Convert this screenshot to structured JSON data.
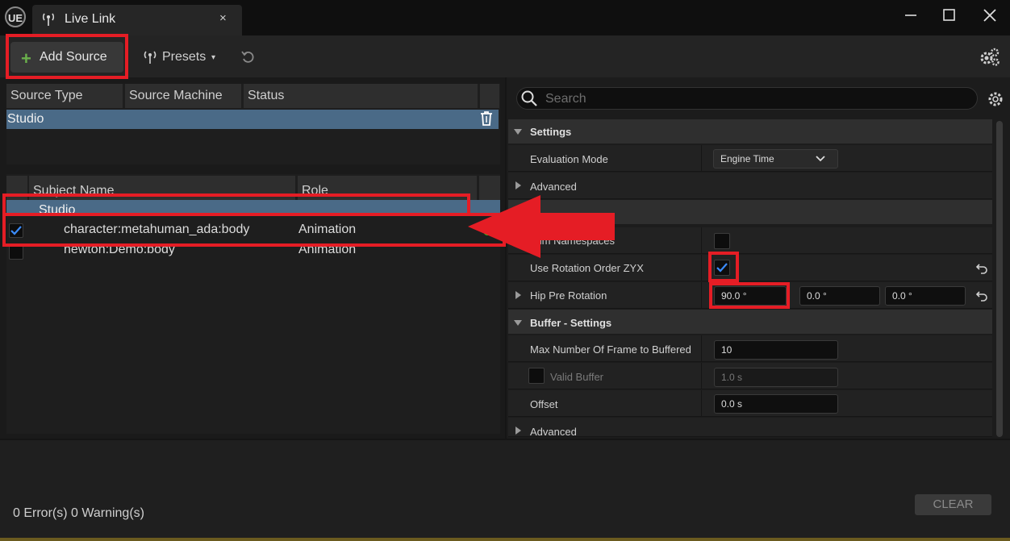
{
  "window": {
    "logo": "UE",
    "tab_title": "Live Link",
    "tab_close": "×"
  },
  "toolbar": {
    "add_source": "Add Source",
    "add_source_icon": "plus-icon",
    "presets": "Presets",
    "presets_caret": "▾"
  },
  "sources": {
    "columns": [
      "Source Type",
      "Source Machine",
      "Status"
    ],
    "row": "Studio"
  },
  "subjects": {
    "columns": [
      "Subject Name",
      "Role"
    ],
    "group": "Studio",
    "items": [
      {
        "name": "character:metahuman_ada:body",
        "role": "Animation",
        "enabled": true
      },
      {
        "name": "newton:Demo:body",
        "role": "Animation",
        "enabled": false
      }
    ]
  },
  "details": {
    "search_placeholder": "Search",
    "settings_category": "Settings",
    "evaluation_mode_label": "Evaluation Mode",
    "evaluation_mode_value": "Engine Time",
    "advanced_label": "Advanced",
    "trim_namespaces_label": "Trim Namespaces",
    "use_rotation_label": "Use Rotation Order ZYX",
    "hip_pre_rotation_label": "Hip Pre Rotation",
    "hip_pre_rotation": [
      "90.0 °",
      "0.0 °",
      "0.0 °"
    ],
    "buffer_category": "Buffer - Settings",
    "max_frames_label": "Max Number Of Frame to Buffered",
    "max_frames_value": "10",
    "valid_buffer_label": "Valid Buffer",
    "valid_buffer_value": "1.0 s",
    "offset_label": "Offset",
    "offset_value": "0.0 s",
    "advanced_label_2": "Advanced"
  },
  "messages": {
    "summary": "0 Error(s)  0 Warning(s)",
    "clear": "CLEAR"
  },
  "colors": {
    "highlight": "#e51d25",
    "selection": "#4a6a87",
    "status_ok": "#19e219",
    "checkbox_check": "#3b8cff"
  }
}
